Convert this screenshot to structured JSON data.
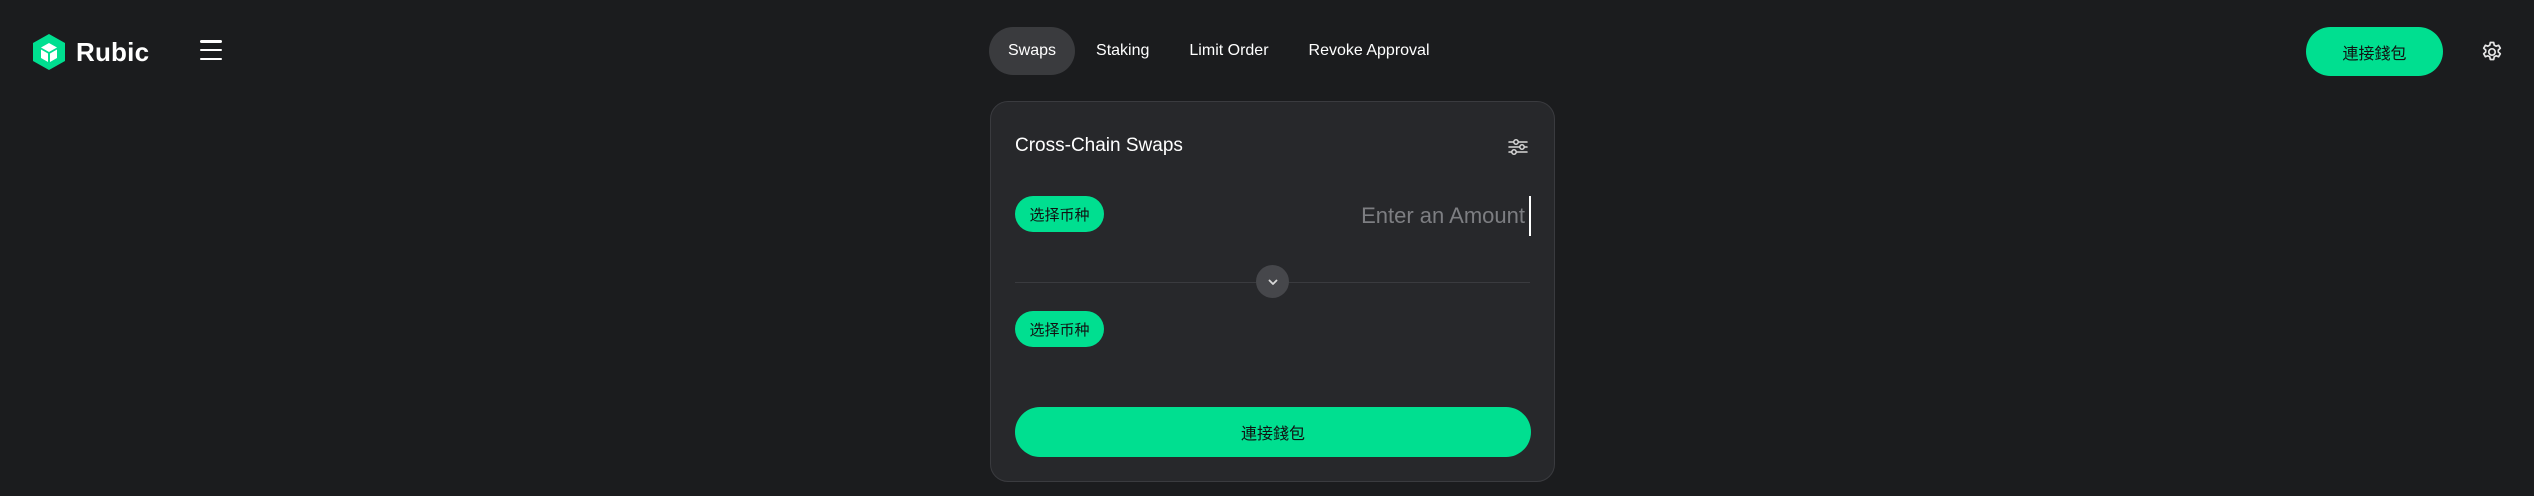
{
  "brand": {
    "name": "Rubic",
    "logo_icon": "rubic-cube-logo",
    "accent_color": "#00df90"
  },
  "header": {
    "menu_icon": "hamburger-menu-icon",
    "nav": [
      {
        "label": "Swaps",
        "active": true
      },
      {
        "label": "Staking",
        "active": false
      },
      {
        "label": "Limit Order",
        "active": false
      },
      {
        "label": "Revoke Approval",
        "active": false
      }
    ],
    "connect_wallet_label": "連接錢包",
    "settings_icon": "gear-icon"
  },
  "swap_card": {
    "title": "Cross-Chain Swaps",
    "settings_icon": "sliders-icon",
    "from": {
      "token_button_label": "选择币种",
      "amount_placeholder": "Enter an Amount",
      "amount_value": ""
    },
    "switch_icon": "chevron-down-icon",
    "to": {
      "token_button_label": "选择币种"
    },
    "connect_wallet_label": "連接錢包"
  }
}
